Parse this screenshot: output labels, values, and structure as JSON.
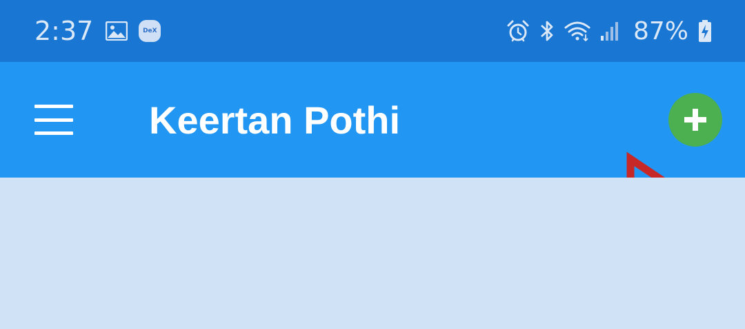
{
  "status_bar": {
    "time": "2:37",
    "dex_label": "DeX",
    "battery_percent": "87%",
    "icons": [
      "image-icon",
      "dex-icon",
      "alarm-icon",
      "bluetooth-icon",
      "wifi-icon",
      "signal-icon",
      "battery-charging-icon"
    ]
  },
  "app_bar": {
    "title": "Keertan Pothi",
    "menu_icon": "hamburger-menu-icon",
    "add_icon": "plus-icon"
  },
  "annotation": {
    "type": "arrow",
    "color": "#c62828",
    "points_to": "add-button"
  },
  "colors": {
    "status_bar": "#1976d2",
    "app_bar": "#2196f3",
    "add_button": "#4caf50",
    "content_background": "#d0e2f6"
  }
}
